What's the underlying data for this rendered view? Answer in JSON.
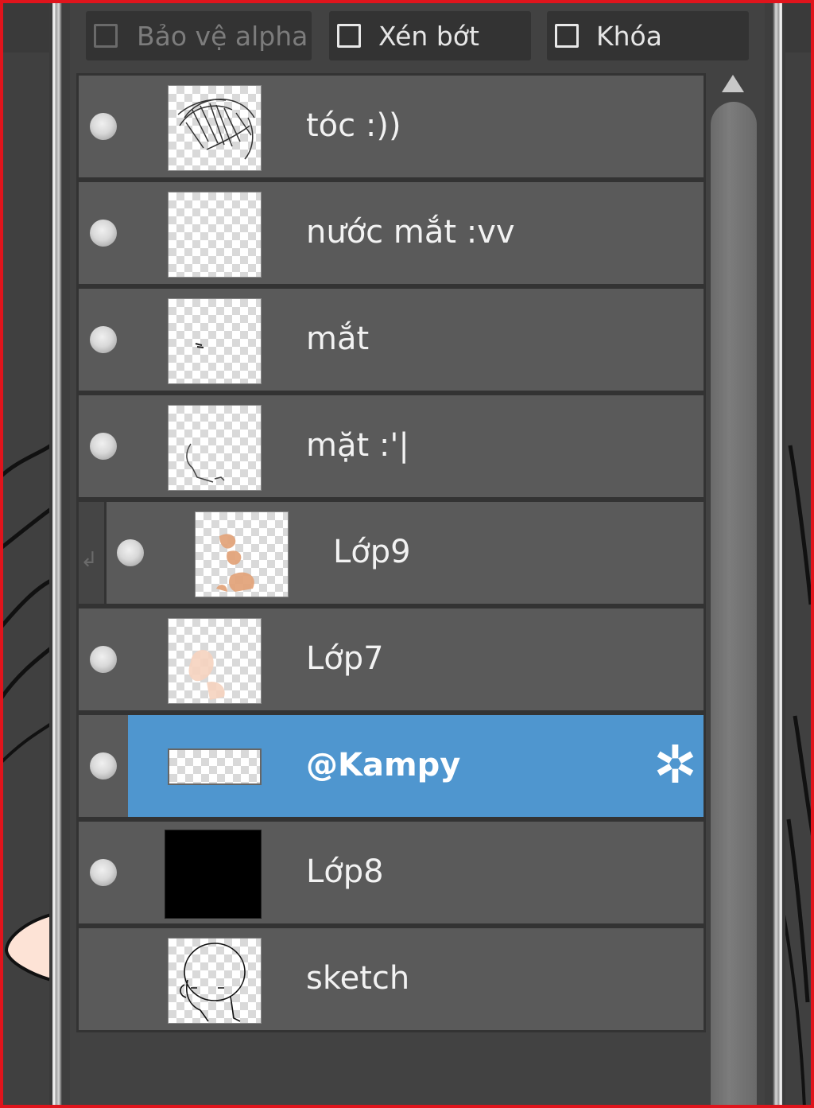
{
  "options": {
    "alpha_protect": {
      "label": "Bảo vệ alpha",
      "checked": false,
      "enabled": false
    },
    "clip": {
      "label": "Xén bớt",
      "checked": false,
      "enabled": true
    },
    "lock": {
      "label": "Khóa",
      "checked": false,
      "enabled": true
    }
  },
  "layers": [
    {
      "name": "tóc :))",
      "visible": true,
      "thumb": "hair-sketch"
    },
    {
      "name": "nước mắt :vv",
      "visible": true,
      "thumb": "empty"
    },
    {
      "name": "mắt",
      "visible": true,
      "thumb": "eye-mark"
    },
    {
      "name": "mặt :'|",
      "visible": true,
      "thumb": "face-line"
    },
    {
      "name": "Lớp9",
      "visible": true,
      "thumb": "orange-strokes",
      "clipped": true
    },
    {
      "name": "Lớp7",
      "visible": true,
      "thumb": "skin-blob"
    },
    {
      "name": "@Kampy",
      "visible": true,
      "thumb": "text-layer",
      "selected": true
    },
    {
      "name": "Lớp8",
      "visible": true,
      "thumb": "black-fill"
    },
    {
      "name": "sketch",
      "visible": false,
      "thumb": "head-sketch"
    }
  ],
  "colors": {
    "selected": "#4f96cf",
    "panel": "#5a5a5a",
    "frame": "#e0141c"
  },
  "icons": {
    "settings": "gear-icon",
    "scroll_up": "triangle-up-icon",
    "clip_indicator": "clip-arrow-icon"
  }
}
